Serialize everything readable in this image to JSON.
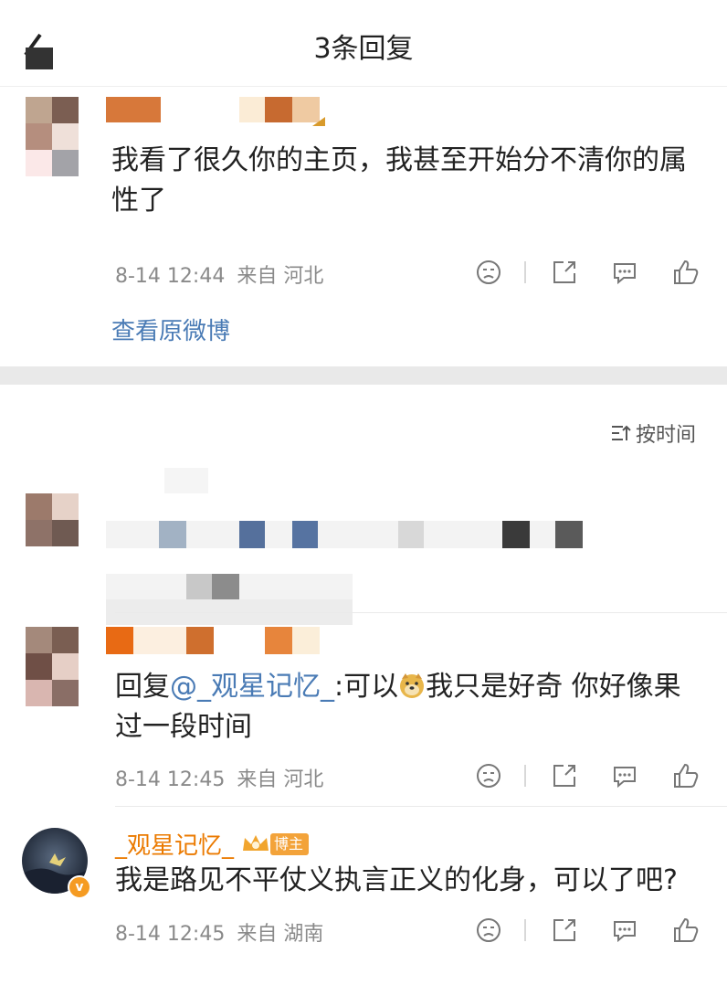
{
  "header": {
    "title": "3条回复",
    "back_label": "back"
  },
  "original": {
    "text_line1": "我看了很久你的主页，我甚至开始分不清你的属",
    "text_line2": "性了",
    "time": "8-14 12:44",
    "location": "来自 河北",
    "view_original": "查看原微博"
  },
  "sort": {
    "label": "按时间"
  },
  "reply1": {
    "prefix": "回复",
    "mention": "@_观星记忆_",
    "text_a": ":可以",
    "text_b": "我只是好奇 你好像果",
    "text_line2": "过一段时间",
    "time": "8-14 12:45",
    "location": "来自 河北"
  },
  "reply2": {
    "name": "_观星记忆_",
    "badge": "博主",
    "text": "我是路见不平仗义执言正义的化身，可以了吧?",
    "time": "8-14 12:45",
    "location": "来自 湖南",
    "verified": "v"
  },
  "icons": [
    "back-icon",
    "dislike-icon",
    "share-icon",
    "comment-icon",
    "like-icon",
    "sort-icon",
    "doge-emoji",
    "vip-crown-icon",
    "verified-icon"
  ],
  "colors": {
    "accent": "#eb7a00",
    "link": "#4a7bb5",
    "meta": "#8a8a8a"
  }
}
